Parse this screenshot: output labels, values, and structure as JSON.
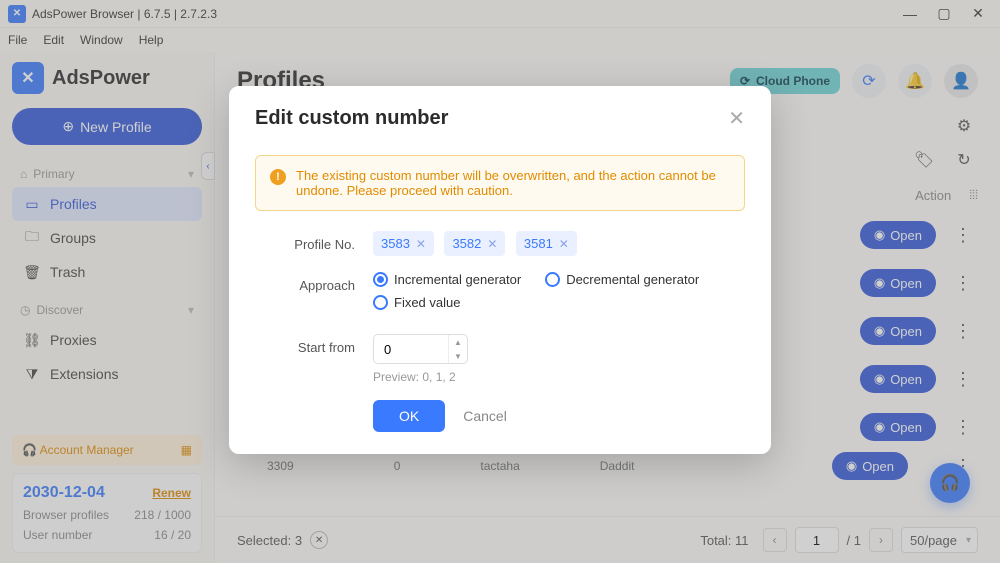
{
  "window": {
    "title": "AdsPower Browser | 6.7.5 | 2.7.2.3"
  },
  "menu": {
    "file": "File",
    "edit": "Edit",
    "window": "Window",
    "help": "Help"
  },
  "brand": "AdsPower",
  "sidebar": {
    "new_profile": "New Profile",
    "primary_label": "Primary",
    "discover_label": "Discover",
    "items": {
      "profiles": "Profiles",
      "groups": "Groups",
      "trash": "Trash",
      "proxies": "Proxies",
      "extensions": "Extensions"
    },
    "account_manager": "Account Manager",
    "plan": {
      "date": "2030-12-04",
      "renew": "Renew",
      "browser_profiles_label": "Browser profiles",
      "browser_profiles_value": "218 / 1000",
      "user_number_label": "User number",
      "user_number_value": "16 / 20"
    }
  },
  "header": {
    "title": "Profiles",
    "cloud": "Cloud Phone"
  },
  "table": {
    "action_col": "Action",
    "open": "Open",
    "partial_id": "3309",
    "partial_text1": "tactaha",
    "partial_text2": "Daddit"
  },
  "footer": {
    "selected_label": "Selected: 3",
    "total_label": "Total: 11",
    "page": "1",
    "total_pages": "/ 1",
    "page_size": "50/page"
  },
  "modal": {
    "title": "Edit custom number",
    "warning": "The existing custom number will be overwritten, and the action cannot be undone. Please proceed with caution.",
    "profile_no_label": "Profile No.",
    "profile_nos": [
      "3583",
      "3582",
      "3581"
    ],
    "approach_label": "Approach",
    "approach_incremental": "Incremental generator",
    "approach_decremental": "Decremental generator",
    "approach_fixed": "Fixed value",
    "start_from_label": "Start from",
    "start_from_value": "0",
    "preview": "Preview: 0, 1, 2",
    "ok": "OK",
    "cancel": "Cancel"
  }
}
